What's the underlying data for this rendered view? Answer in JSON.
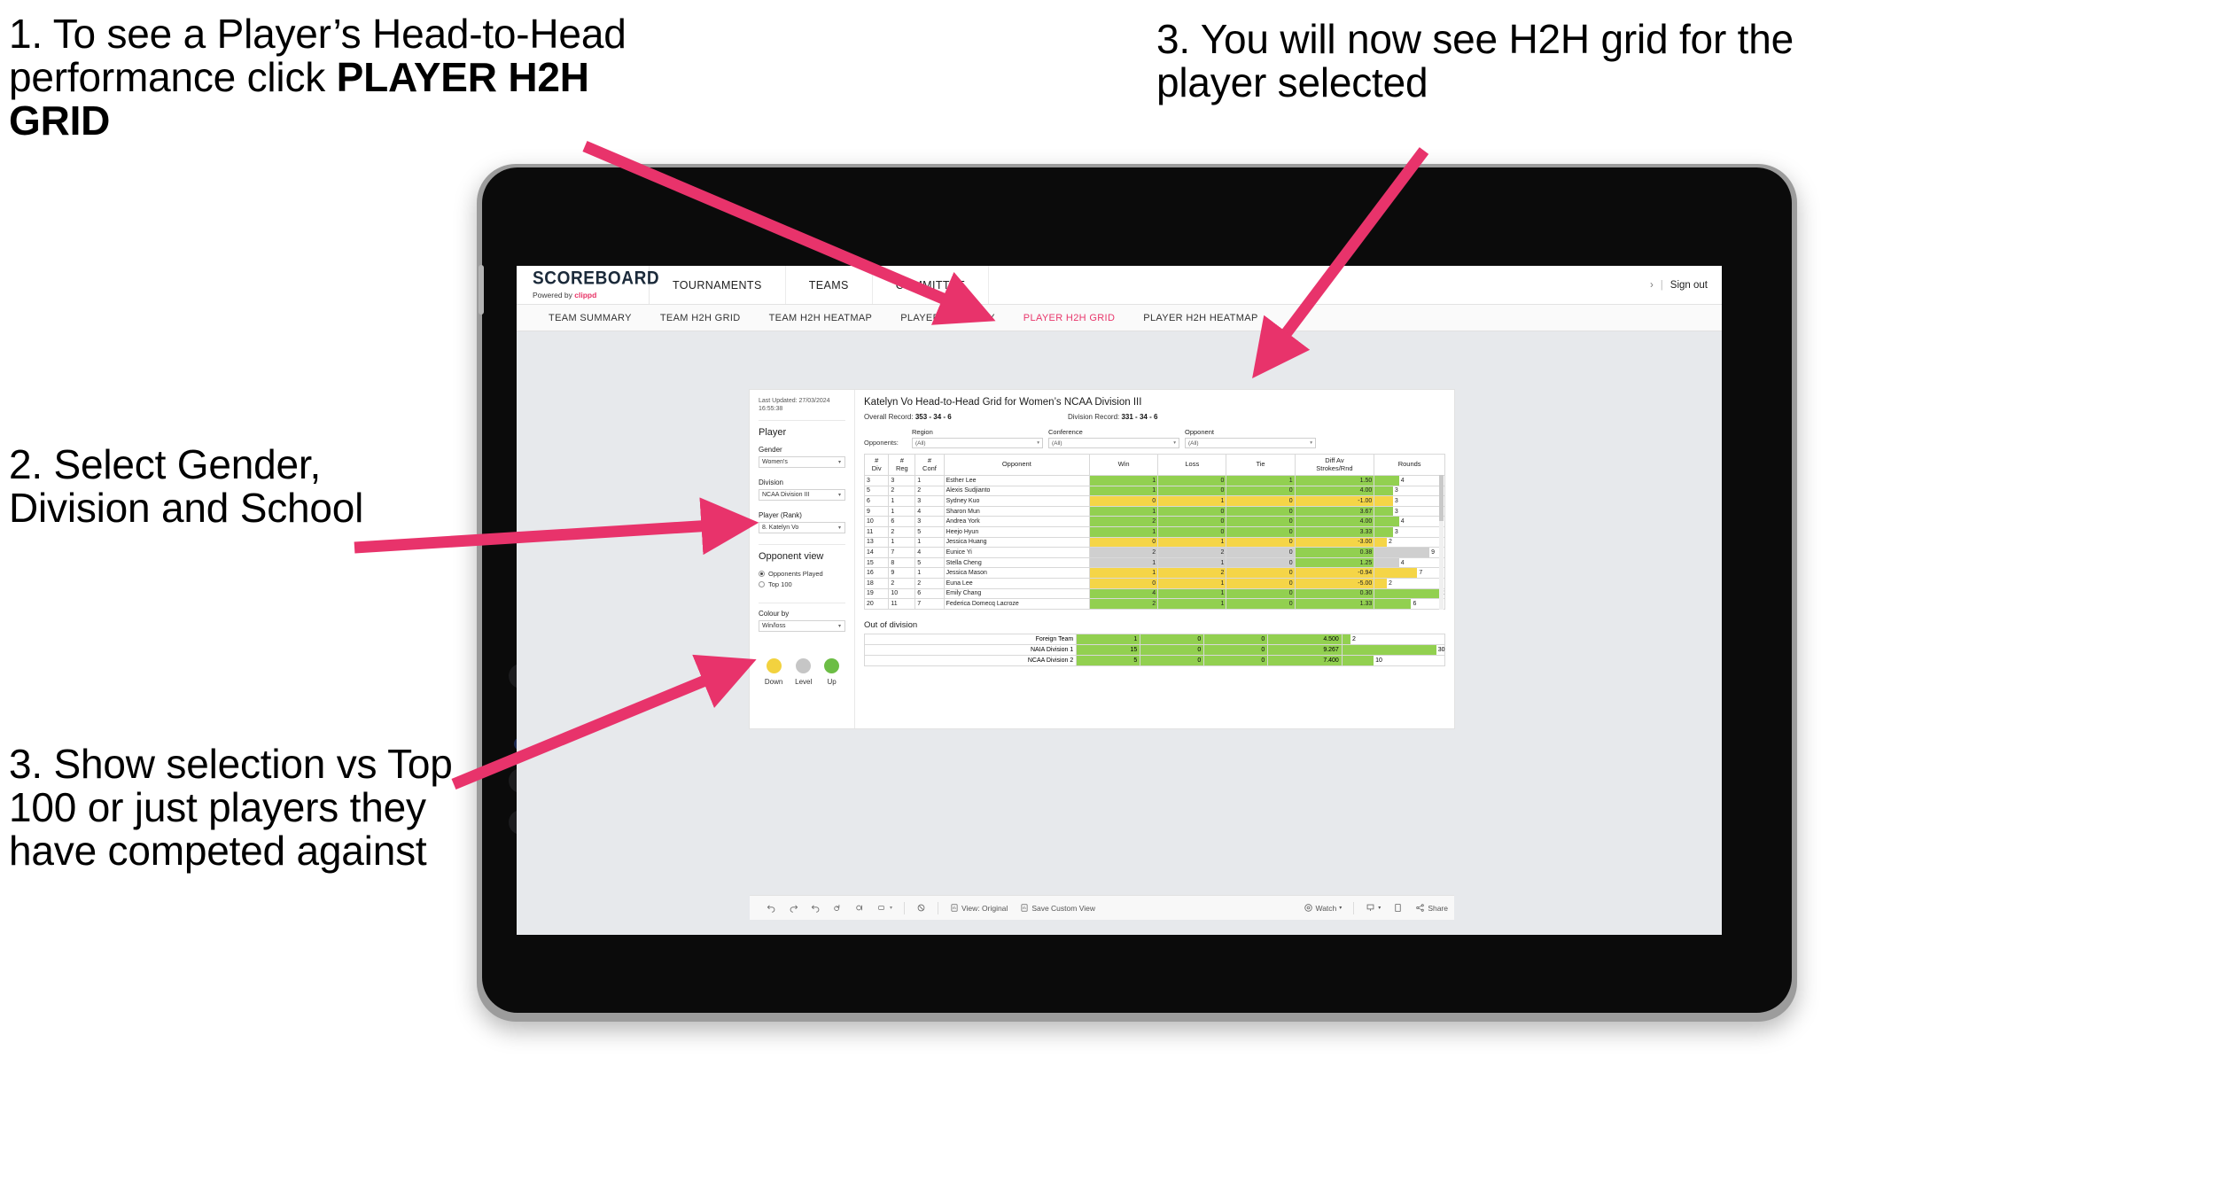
{
  "annotations": {
    "a1_part1": "1. To see a Player’s Head-to-Head performance click ",
    "a1_bold": "PLAYER H2H GRID",
    "a2": "2. Select Gender, Division and School",
    "a3": "3. Show selection vs Top 100 or just players they have competed against",
    "a4": "3. You will now see H2H grid for the player selected"
  },
  "app": {
    "brand": {
      "name": "SCOREBOARD",
      "powered_prefix": "Powered by ",
      "powered_brand": "clippd"
    },
    "top_nav": [
      "TOURNAMENTS",
      "TEAMS",
      "COMMITTEE"
    ],
    "top_right": {
      "chevron": "›",
      "divider": "|",
      "sign_out": "Sign out"
    },
    "sub_nav": [
      {
        "label": "TEAM SUMMARY",
        "active": false
      },
      {
        "label": "TEAM H2H GRID",
        "active": false
      },
      {
        "label": "TEAM H2H HEATMAP",
        "active": false
      },
      {
        "label": "PLAYER SUMMARY",
        "active": false
      },
      {
        "label": "PLAYER H2H GRID",
        "active": true
      },
      {
        "label": "PLAYER H2H HEATMAP",
        "active": false
      }
    ],
    "accent_pink": "#e8366b"
  },
  "filters": {
    "last_updated": "Last Updated: 27/03/2024 16:55:38",
    "player_heading": "Player",
    "gender": {
      "label": "Gender",
      "value": "Women's"
    },
    "division": {
      "label": "Division",
      "value": "NCAA Division III"
    },
    "player_rank": {
      "label": "Player (Rank)",
      "value": "8. Katelyn Vo"
    },
    "opponent_view": {
      "heading": "Opponent view",
      "options": [
        {
          "label": "Opponents Played",
          "selected": true
        },
        {
          "label": "Top 100",
          "selected": false
        }
      ]
    },
    "colour_by": {
      "label": "Colour by",
      "value": "Win/loss"
    },
    "legend": [
      {
        "label": "Down",
        "color": "#f2d23f"
      },
      {
        "label": "Level",
        "color": "#c6c6c6"
      },
      {
        "label": "Up",
        "color": "#6cbd45"
      }
    ]
  },
  "viz": {
    "title": "Katelyn Vo Head-to-Head Grid for Women’s NCAA Division III",
    "overall_record_label": "Overall Record:",
    "overall_record_value": "353 -  34 - 6",
    "division_record_label": "Division Record:",
    "division_record_value": "331 -  34 - 6",
    "opponents_label": "Opponents:",
    "opponent_filters": [
      {
        "caption": "Region",
        "value": "(All)"
      },
      {
        "caption": "Conference",
        "value": "(All)"
      },
      {
        "caption": "Opponent",
        "value": "(All)"
      }
    ],
    "columns": [
      "# Div",
      "# Reg",
      "# Conf",
      "Opponent",
      "Win",
      "Loss",
      "Tie",
      "Diff Av Strokes/Rnd",
      "Rounds"
    ],
    "columns_split": [
      {
        "l1": "#",
        "l2": "Div"
      },
      {
        "l1": "#",
        "l2": "Reg"
      },
      {
        "l1": "#",
        "l2": "Conf"
      },
      {
        "l1": "Opponent",
        "l2": ""
      },
      {
        "l1": "Win",
        "l2": ""
      },
      {
        "l1": "Loss",
        "l2": ""
      },
      {
        "l1": "Tie",
        "l2": ""
      },
      {
        "l1": "Diff Av",
        "l2": "Strokes/Rnd"
      },
      {
        "l1": "Rounds",
        "l2": ""
      }
    ],
    "rows": [
      {
        "div": "3",
        "reg": "3",
        "conf": "1",
        "opponent": "Esther Lee",
        "win": "1",
        "loss": "0",
        "tie": "1",
        "diff": "1.50",
        "rounds": "4",
        "state": "up"
      },
      {
        "div": "5",
        "reg": "2",
        "conf": "2",
        "opponent": "Alexis Sudjianto",
        "win": "1",
        "loss": "0",
        "tie": "0",
        "diff": "4.00",
        "rounds": "3",
        "state": "up"
      },
      {
        "div": "6",
        "reg": "1",
        "conf": "3",
        "opponent": "Sydney Kuo",
        "win": "0",
        "loss": "1",
        "tie": "0",
        "diff": "-1.00",
        "rounds": "3",
        "state": "down"
      },
      {
        "div": "9",
        "reg": "1",
        "conf": "4",
        "opponent": "Sharon Mun",
        "win": "1",
        "loss": "0",
        "tie": "0",
        "diff": "3.67",
        "rounds": "3",
        "state": "up"
      },
      {
        "div": "10",
        "reg": "6",
        "conf": "3",
        "opponent": "Andrea York",
        "win": "2",
        "loss": "0",
        "tie": "0",
        "diff": "4.00",
        "rounds": "4",
        "state": "up"
      },
      {
        "div": "11",
        "reg": "2",
        "conf": "5",
        "opponent": "Heejo Hyun",
        "win": "1",
        "loss": "0",
        "tie": "0",
        "diff": "3.33",
        "rounds": "3",
        "state": "up"
      },
      {
        "div": "13",
        "reg": "1",
        "conf": "1",
        "opponent": "Jessica Huang",
        "win": "0",
        "loss": "1",
        "tie": "0",
        "diff": "-3.00",
        "rounds": "2",
        "state": "down"
      },
      {
        "div": "14",
        "reg": "7",
        "conf": "4",
        "opponent": "Eunice Yi",
        "win": "2",
        "loss": "2",
        "tie": "0",
        "diff": "0.38",
        "rounds": "9",
        "state": "level"
      },
      {
        "div": "15",
        "reg": "8",
        "conf": "5",
        "opponent": "Stella Cheng",
        "win": "1",
        "loss": "1",
        "tie": "0",
        "diff": "1.25",
        "rounds": "4",
        "state": "level"
      },
      {
        "div": "16",
        "reg": "9",
        "conf": "1",
        "opponent": "Jessica Mason",
        "win": "1",
        "loss": "2",
        "tie": "0",
        "diff": "-0.94",
        "rounds": "7",
        "state": "down"
      },
      {
        "div": "18",
        "reg": "2",
        "conf": "2",
        "opponent": "Euna Lee",
        "win": "0",
        "loss": "1",
        "tie": "0",
        "diff": "-5.00",
        "rounds": "2",
        "state": "down"
      },
      {
        "div": "19",
        "reg": "10",
        "conf": "6",
        "opponent": "Emily Chang",
        "win": "4",
        "loss": "1",
        "tie": "0",
        "diff": "0.30",
        "rounds": "11",
        "state": "up"
      },
      {
        "div": "20",
        "reg": "11",
        "conf": "7",
        "opponent": "Federica Domecq Lacroze",
        "win": "2",
        "loss": "1",
        "tie": "0",
        "diff": "1.33",
        "rounds": "6",
        "state": "up"
      }
    ],
    "out_of_division": {
      "title": "Out of division",
      "rows": [
        {
          "name": "Foreign Team",
          "win": "1",
          "loss": "0",
          "tie": "0",
          "diff": "4.500",
          "rounds": "2",
          "state": "up"
        },
        {
          "name": "NAIA Division 1",
          "win": "15",
          "loss": "0",
          "tie": "0",
          "diff": "9.267",
          "rounds": "30",
          "state": "up"
        },
        {
          "name": "NCAA Division 2",
          "win": "5",
          "loss": "0",
          "tie": "0",
          "diff": "7.400",
          "rounds": "10",
          "state": "up"
        }
      ]
    }
  },
  "toolbar": {
    "view_original": "View: Original",
    "save_custom_view": "Save Custom View",
    "watch": "Watch",
    "share": "Share",
    "caret": "▾"
  },
  "chart_data": {
    "type": "table",
    "title": "Katelyn Vo Head-to-Head Grid for Women’s NCAA Division III",
    "categories": [
      "Esther Lee",
      "Alexis Sudjianto",
      "Sydney Kuo",
      "Sharon Mun",
      "Andrea York",
      "Heejo Hyun",
      "Jessica Huang",
      "Eunice Yi",
      "Stella Cheng",
      "Jessica Mason",
      "Euna Lee",
      "Emily Chang",
      "Federica Domecq Lacroze"
    ],
    "series": [
      {
        "name": "Win",
        "values": [
          1,
          1,
          0,
          1,
          2,
          1,
          0,
          2,
          1,
          1,
          0,
          4,
          2
        ]
      },
      {
        "name": "Loss",
        "values": [
          0,
          0,
          1,
          0,
          0,
          0,
          1,
          2,
          1,
          2,
          1,
          1,
          1
        ]
      },
      {
        "name": "Tie",
        "values": [
          1,
          0,
          0,
          0,
          0,
          0,
          0,
          0,
          0,
          0,
          0,
          0,
          0
        ]
      },
      {
        "name": "Diff Av Strokes/Rnd",
        "values": [
          1.5,
          4.0,
          -1.0,
          3.67,
          4.0,
          3.33,
          -3.0,
          0.38,
          1.25,
          -0.94,
          -5.0,
          0.3,
          1.33
        ]
      },
      {
        "name": "Rounds",
        "values": [
          4,
          3,
          3,
          3,
          4,
          3,
          2,
          9,
          4,
          7,
          2,
          11,
          6
        ]
      }
    ],
    "xlabel": "Opponent",
    "ylabel": "",
    "legend": [
      "Down",
      "Level",
      "Up"
    ],
    "colors": {
      "up": "#92d050",
      "level": "#cfcfcf",
      "down": "#f5d547"
    }
  }
}
